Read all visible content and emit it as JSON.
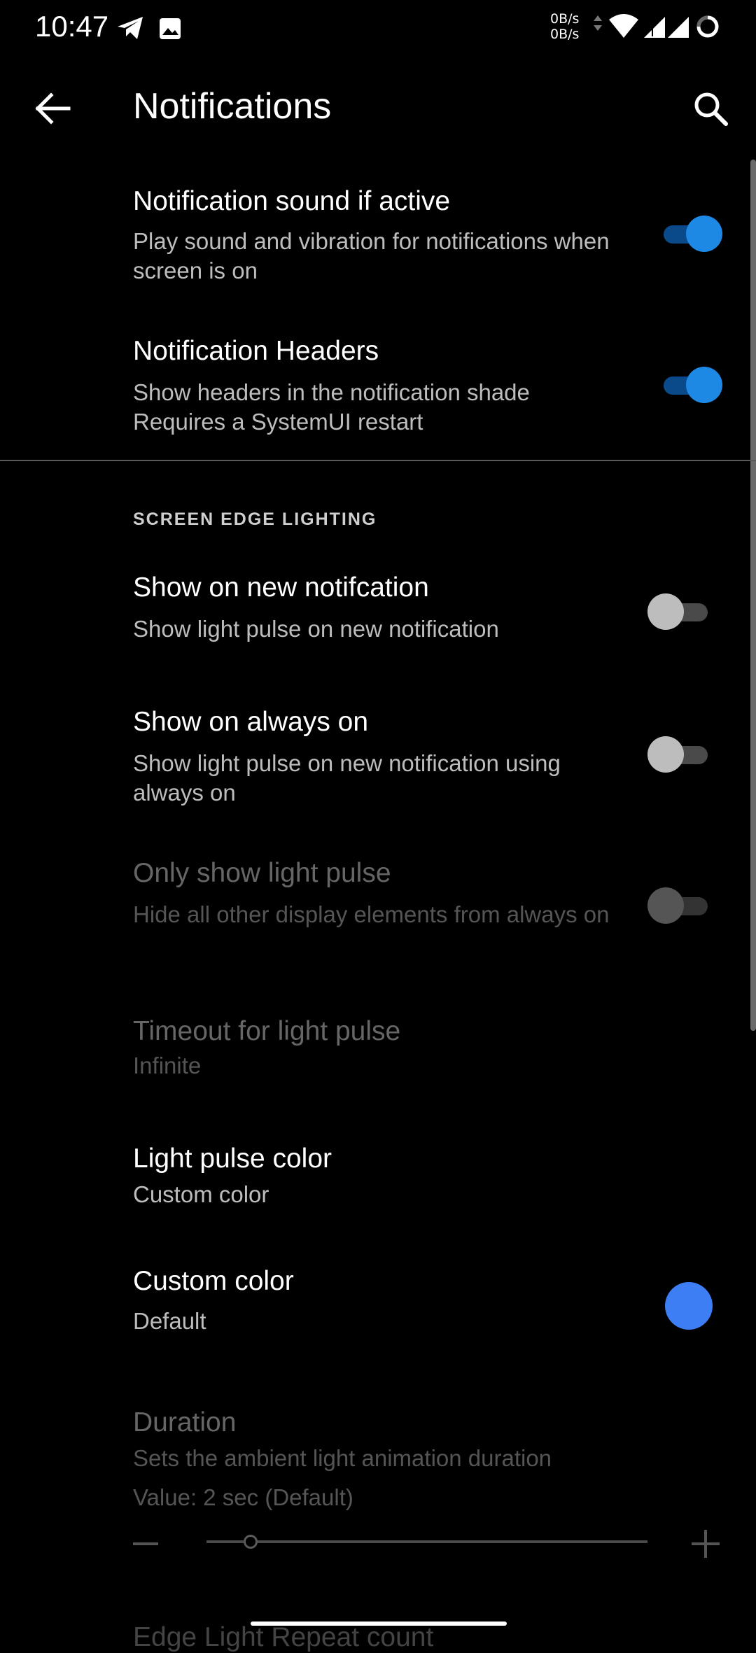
{
  "status_bar": {
    "time": "10:47",
    "net_speed_up": "0B/s",
    "net_speed_down": "0B/s",
    "left_icons": [
      "telegram-icon",
      "image-icon"
    ],
    "right_icons": [
      "wifi-icon",
      "signal-icon",
      "signal-icon",
      "battery-icon"
    ]
  },
  "app_bar": {
    "title": "Notifications",
    "back_icon": "arrow-back-icon",
    "search_icon": "search-icon"
  },
  "settings": [
    {
      "title": "Notification sound if active",
      "subtitle": "Play sound and vibration for notifications when screen is on",
      "toggle": "on"
    },
    {
      "title": "Notification Headers",
      "subtitle": "Show headers in the notification shade\nRequires a SystemUI restart",
      "toggle": "on"
    }
  ],
  "section": {
    "header": "SCREEN EDGE LIGHTING",
    "items": [
      {
        "title": "Show on new notifcation",
        "subtitle": "Show light pulse on new notification",
        "toggle": "off"
      },
      {
        "title": "Show on always on",
        "subtitle": "Show light pulse on new notification using always on",
        "toggle": "off"
      },
      {
        "title": "Only show light pulse",
        "subtitle": "Hide all other display elements from always on",
        "toggle": "off",
        "enabled": false
      },
      {
        "title": "Timeout for light pulse",
        "subtitle": "Infinite",
        "enabled": false
      },
      {
        "title": "Light pulse color",
        "subtitle": "Custom color"
      },
      {
        "title": "Custom color",
        "subtitle": "Default",
        "swatch_color": "#3d7ef5"
      },
      {
        "title": "Duration",
        "subtitle": "Sets the ambient light animation duration",
        "value_text": "Value: 2 sec (Default)",
        "enabled": false,
        "slider_fraction": 0.1
      }
    ],
    "partial_item_title": "Edge Light Repeat count"
  },
  "colors": {
    "accent": "#1e88e5",
    "background": "#000000"
  }
}
